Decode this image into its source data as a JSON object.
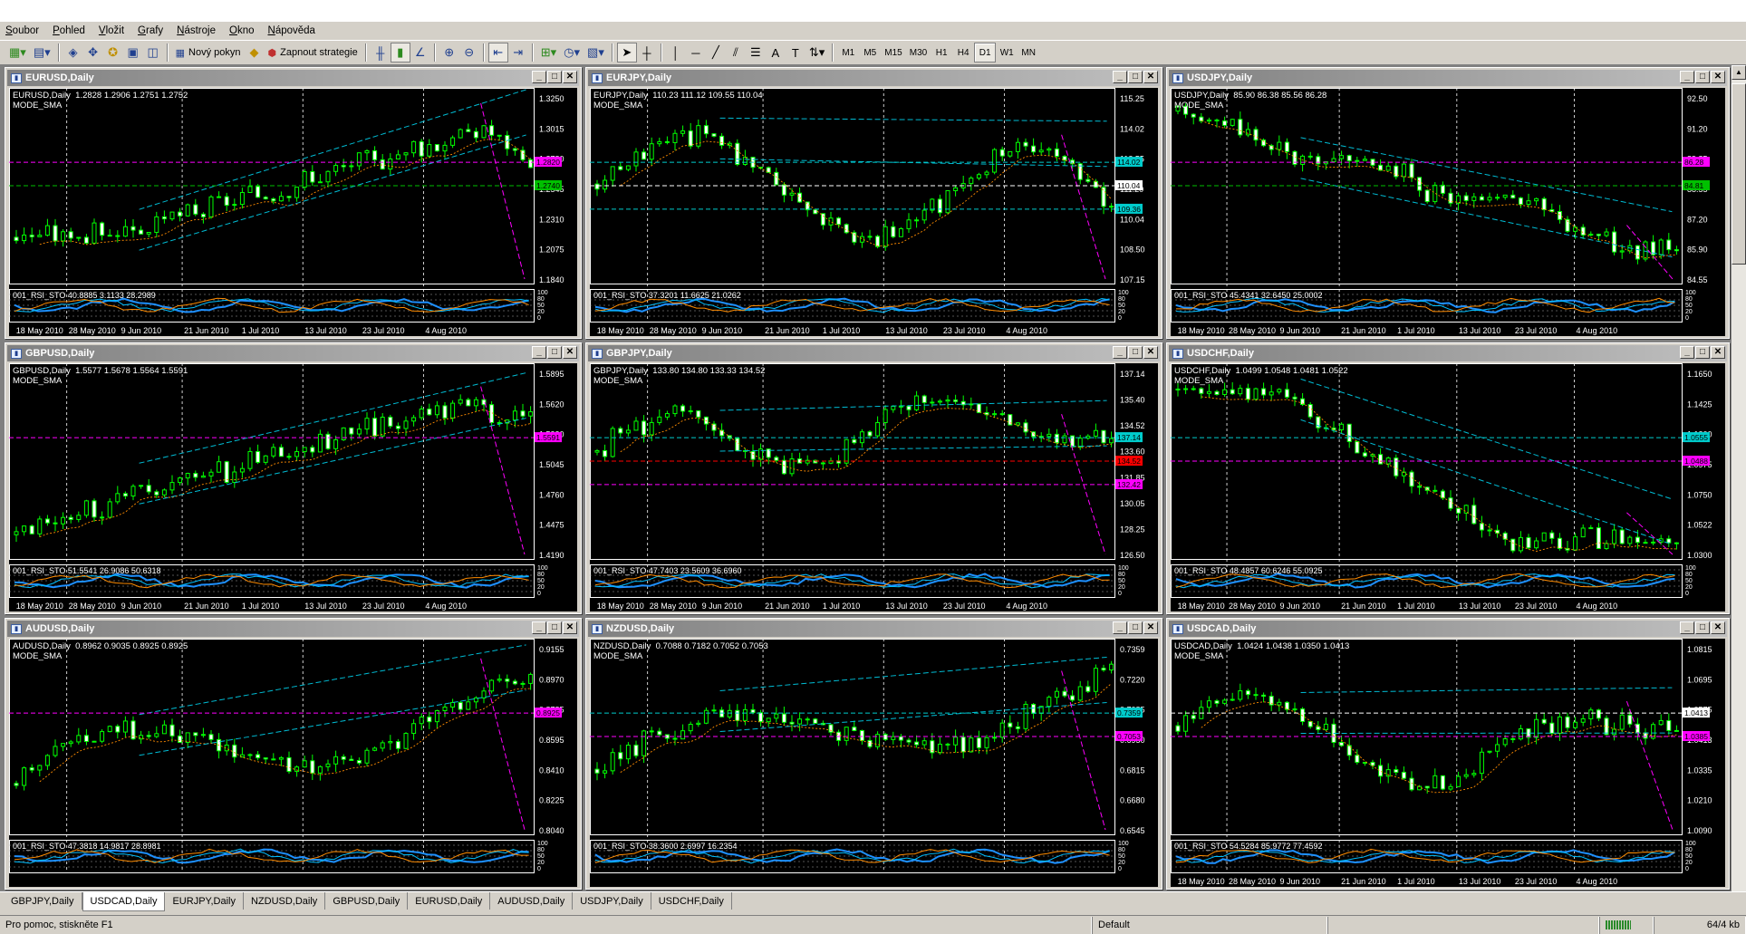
{
  "menu": [
    "Soubor",
    "Pohled",
    "Vložit",
    "Grafy",
    "Nástroje",
    "Okno",
    "Nápověda"
  ],
  "toolbar": {
    "new_order": "Nový pokyn",
    "strategy": "Zapnout strategie",
    "timeframes": [
      "M1",
      "M5",
      "M15",
      "M30",
      "H1",
      "H4",
      "D1",
      "W1",
      "MN"
    ],
    "active_tf": "D1"
  },
  "charts": [
    {
      "title": "EURUSD,Daily",
      "info": "EURUSD,Daily  1.2828 1.2906 1.2751 1.2752",
      "mode": "MODE_SMA",
      "ind": "001_RSI_STO 40.8885 3.1133 28.2989",
      "prices": [
        "1.3250",
        "1.3015",
        "1.2780",
        "1.2545",
        "1.2310",
        "1.2075",
        "1.1840"
      ],
      "tags": [
        {
          "v": "1.2820",
          "c": "#ff00ff"
        },
        {
          "v": "1.2740",
          "c": "#00c000"
        }
      ],
      "dates": [
        "18 May 2010",
        "28 May 2010",
        "9 Jun 2010",
        "21 Jun 2010",
        "1 Jul 2010",
        "13 Jul 2010",
        "23 Jul 2010",
        "4 Aug 2010"
      ],
      "vlines": [
        "28 May 2010",
        "21 Jun 2010",
        "13 Jul 2010",
        "4 Aug 2010"
      ]
    },
    {
      "title": "EURJPY,Daily",
      "info": "EURJPY,Daily  110.23 111.12 109.55 110.04",
      "mode": "MODE_SMA",
      "ind": "001_RSI_STO 37.3201 11.6625 21.0262",
      "prices": [
        "115.25",
        "114.02",
        "112.55",
        "111.20",
        "110.04",
        "108.50",
        "107.15"
      ],
      "tags": [
        {
          "v": "114.02",
          "c": "#00cccc"
        },
        {
          "v": "110.04",
          "c": "#ffffff"
        },
        {
          "v": "109.36",
          "c": "#00cccc"
        }
      ],
      "dates": [
        "18 May 2010",
        "28 May 2010",
        "9 Jun 2010",
        "21 Jun 2010",
        "1 Jul 2010",
        "13 Jul 2010",
        "23 Jul 2010",
        "4 Aug 2010"
      ],
      "vlines": [
        "28 May 2010",
        "21 Jun 2010",
        "13 Jul 2010",
        "4 Aug 2010"
      ]
    },
    {
      "title": "USDJPY,Daily",
      "info": "USDJPY,Daily  85.90 86.38 85.56 86.28",
      "mode": "MODE_SMA",
      "ind": "001_RSI_STO 45.4341 32.6450 25.0002",
      "prices": [
        "92.50",
        "91.20",
        "89.85",
        "88.55",
        "87.20",
        "85.90",
        "84.55"
      ],
      "tags": [
        {
          "v": "86.28",
          "c": "#ff00ff"
        },
        {
          "v": "84.81",
          "c": "#00c000"
        }
      ],
      "dates": [
        "18 May 2010",
        "28 May 2010",
        "9 Jun 2010",
        "21 Jun 2010",
        "1 Jul 2010",
        "13 Jul 2010",
        "23 Jul 2010",
        "4 Aug 2010"
      ],
      "vlines": [
        "28 May 2010",
        "21 Jun 2010",
        "13 Jul 2010",
        "4 Aug 2010"
      ]
    },
    {
      "title": "GBPUSD,Daily",
      "info": "GBPUSD,Daily  1.5577 1.5678 1.5564 1.5591",
      "mode": "MODE_SMA",
      "ind": "001_RSI_STO 51.5541 26.9086 50.6318",
      "prices": [
        "1.5895",
        "1.5620",
        "1.5330",
        "1.5045",
        "1.4760",
        "1.4475",
        "1.4190"
      ],
      "tags": [
        {
          "v": "1.5591",
          "c": "#ff00ff"
        }
      ],
      "dates": [
        "18 May 2010",
        "28 May 2010",
        "9 Jun 2010",
        "21 Jun 2010",
        "1 Jul 2010",
        "13 Jul 2010",
        "23 Jul 2010",
        "4 Aug 2010"
      ],
      "vlines": [
        "28 May 2010",
        "21 Jun 2010",
        "13 Jul 2010",
        "4 Aug 2010"
      ]
    },
    {
      "title": "GBPJPY,Daily",
      "info": "GBPJPY,Daily  133.80 134.80 133.33 134.52",
      "mode": "MODE_SMA",
      "ind": "001_RSI_STO 47.7403 23.5609 36.6960",
      "prices": [
        "137.14",
        "135.40",
        "134.52",
        "133.60",
        "131.85",
        "130.05",
        "128.25",
        "126.50"
      ],
      "tags": [
        {
          "v": "137.14",
          "c": "#00cccc"
        },
        {
          "v": "134.52",
          "c": "#ff0000"
        },
        {
          "v": "132.42",
          "c": "#ff00ff"
        }
      ],
      "dates": [
        "18 May 2010",
        "28 May 2010",
        "9 Jun 2010",
        "21 Jun 2010",
        "1 Jul 2010",
        "13 Jul 2010",
        "23 Jul 2010",
        "4 Aug 2010"
      ],
      "vlines": [
        "28 May 2010",
        "21 Jun 2010",
        "13 Jul 2010",
        "4 Aug 2010"
      ]
    },
    {
      "title": "USDCHF,Daily",
      "info": "USDCHF,Daily  1.0499 1.0548 1.0481 1.0522",
      "mode": "MODE_SMA",
      "ind": "001_RSI_STO 48.4857 60.6246 55.0925",
      "prices": [
        "1.1650",
        "1.1425",
        "1.1200",
        "1.0975",
        "1.0750",
        "1.0522",
        "1.0300"
      ],
      "tags": [
        {
          "v": "1.0555",
          "c": "#00cccc"
        },
        {
          "v": "1.0488",
          "c": "#ff00ff"
        }
      ],
      "dates": [
        "18 May 2010",
        "28 May 2010",
        "9 Jun 2010",
        "21 Jun 2010",
        "1 Jul 2010",
        "13 Jul 2010",
        "23 Jul 2010",
        "4 Aug 2010"
      ],
      "vlines": [
        "28 May 2010",
        "21 Jun 2010",
        "13 Jul 2010",
        "4 Aug 2010"
      ]
    },
    {
      "title": "AUDUSD,Daily",
      "info": "AUDUSD,Daily  0.8962 0.9035 0.8925 0.8925",
      "mode": "MODE_SMA",
      "ind": "001_RSI_STO 47.3818 14.9817 28.8981",
      "prices": [
        "0.9155",
        "0.8970",
        "0.8785",
        "0.8595",
        "0.8410",
        "0.8225",
        "0.8040"
      ],
      "tags": [
        {
          "v": "0.8925",
          "c": "#ff00ff"
        }
      ],
      "dates": [],
      "vlines": [
        "28 May 2010",
        "21 Jun 2010",
        "13 Jul 2010",
        "4 Aug 2010"
      ]
    },
    {
      "title": "NZDUSD,Daily",
      "info": "NZDUSD,Daily  0.7088 0.7182 0.7052 0.7053",
      "mode": "MODE_SMA",
      "ind": "001_RSI_STO 38.3600 2.6997 16.2354",
      "prices": [
        "0.7359",
        "0.7220",
        "0.7085",
        "0.6950",
        "0.6815",
        "0.6680",
        "0.6545"
      ],
      "tags": [
        {
          "v": "0.7359",
          "c": "#00cccc"
        },
        {
          "v": "0.7053",
          "c": "#ff00ff"
        }
      ],
      "dates": [],
      "vlines": [
        "28 May 2010",
        "21 Jun 2010",
        "13 Jul 2010",
        "4 Aug 2010"
      ]
    },
    {
      "title": "USDCAD,Daily",
      "info": "USDCAD,Daily  1.0424 1.0438 1.0350 1.0413",
      "mode": "MODE_SMA",
      "ind": "001_RSI_STO 54.5284 85.9772 77.4592",
      "prices": [
        "1.0815",
        "1.0695",
        "1.0575",
        "1.0413",
        "1.0335",
        "1.0210",
        "1.0090"
      ],
      "tags": [
        {
          "v": "1.0413",
          "c": "#ffffff"
        },
        {
          "v": "1.0385",
          "c": "#ff00ff"
        }
      ],
      "dates": [
        "18 May 2010",
        "28 May 2010",
        "9 Jun 2010",
        "21 Jun 2010",
        "1 Jul 2010",
        "13 Jul 2010",
        "23 Jul 2010",
        "4 Aug 2010"
      ],
      "vlines": [
        "28 May 2010",
        "21 Jun 2010",
        "13 Jul 2010",
        "4 Aug 2010"
      ]
    }
  ],
  "tabs": [
    "GBPJPY,Daily",
    "USDCAD,Daily",
    "EURJPY,Daily",
    "NZDUSD,Daily",
    "GBPUSD,Daily",
    "EURUSD,Daily",
    "AUDUSD,Daily",
    "USDJPY,Daily",
    "USDCHF,Daily"
  ],
  "active_tab": "USDCAD,Daily",
  "status": {
    "help": "Pro pomoc, stiskněte F1",
    "profile": "Default",
    "traffic": "64/4 kb"
  },
  "indicator_scale": [
    "100",
    "80",
    "50",
    "20",
    "0"
  ]
}
